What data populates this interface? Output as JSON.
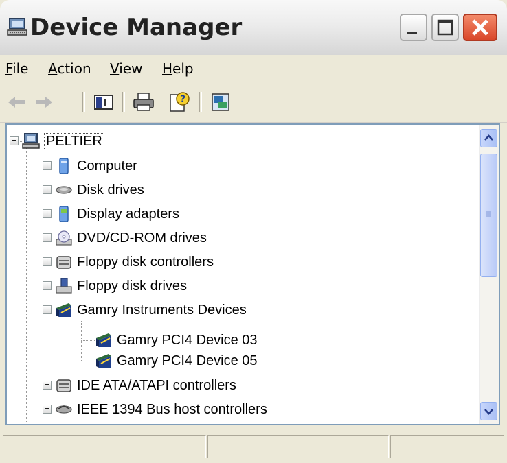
{
  "window": {
    "title": "Device Manager"
  },
  "menubar": {
    "items": [
      {
        "label": "File",
        "accel": "F"
      },
      {
        "label": "Action",
        "accel": "A"
      },
      {
        "label": "View",
        "accel": "V"
      },
      {
        "label": "Help",
        "accel": "H"
      }
    ]
  },
  "toolbar": {
    "buttons": [
      "back-arrow-icon",
      "forward-arrow-icon",
      "show-hide-console-tree-icon",
      "print-icon",
      "help-icon",
      "properties-icon"
    ]
  },
  "tree": {
    "root": {
      "label": "PELTIER",
      "expanded": true
    },
    "items": [
      {
        "label": "Computer",
        "icon": "computer-icon",
        "expanded": false
      },
      {
        "label": "Disk drives",
        "icon": "disk-drive-icon",
        "expanded": false
      },
      {
        "label": "Display adapters",
        "icon": "display-adapter-icon",
        "expanded": false
      },
      {
        "label": "DVD/CD-ROM drives",
        "icon": "cdrom-icon",
        "expanded": false
      },
      {
        "label": "Floppy disk controllers",
        "icon": "controller-icon",
        "expanded": false
      },
      {
        "label": "Floppy disk drives",
        "icon": "floppy-drive-icon",
        "expanded": false
      },
      {
        "label": "Gamry Instruments Devices",
        "icon": "gamry-device-icon",
        "expanded": true,
        "children": [
          {
            "label": "Gamry PCI4 Device 03",
            "icon": "gamry-device-icon"
          },
          {
            "label": "Gamry PCI4 Device 05",
            "icon": "gamry-device-icon"
          }
        ]
      },
      {
        "label": "IDE ATA/ATAPI controllers",
        "icon": "controller-icon",
        "expanded": false
      },
      {
        "label": "IEEE 1394 Bus host controllers",
        "icon": "ieee1394-icon",
        "expanded": false
      }
    ]
  },
  "colors": {
    "window_bg": "#ece9d8",
    "tree_border": "#7f9db9",
    "close_button": "#d9472a"
  }
}
